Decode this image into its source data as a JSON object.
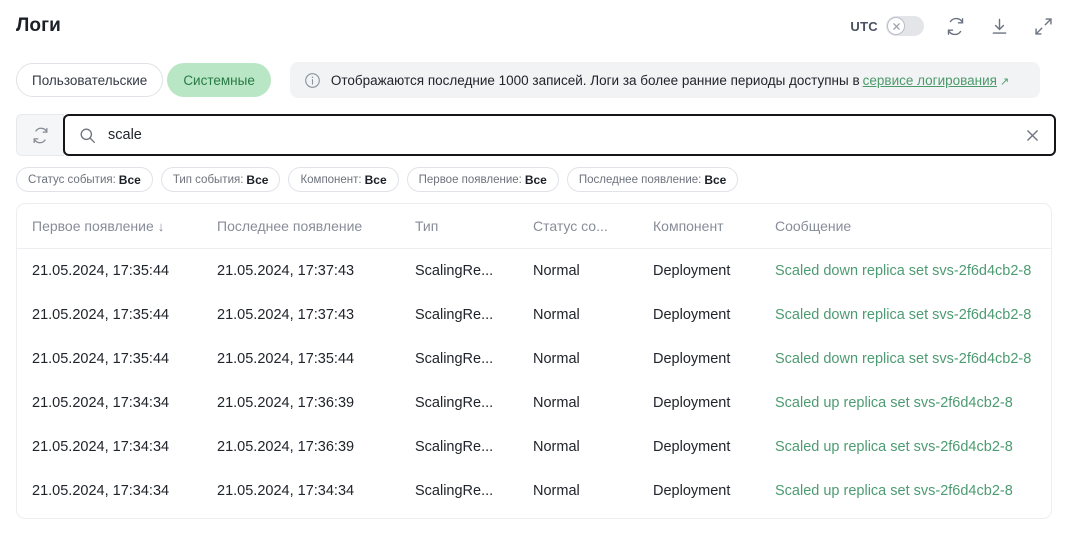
{
  "header": {
    "title": "Логи",
    "utc_label": "UTC",
    "utc_enabled": false,
    "icons": {
      "refresh": "refresh-icon",
      "download": "download-icon",
      "expand": "expand-icon"
    }
  },
  "tabs": [
    {
      "label": "Пользовательские",
      "active": false
    },
    {
      "label": "Системные",
      "active": true
    }
  ],
  "banner": {
    "text": "Отображаются последние 1000 записей. Логи за более ранние периоды доступны в",
    "link": "сервисе логирования",
    "link_arrow": "↗"
  },
  "search": {
    "value": "scale",
    "placeholder": "",
    "refresh_icon": "refresh-icon",
    "search_icon": "search-icon",
    "clear_icon": "close-icon"
  },
  "filters": [
    {
      "label": "Статус события:",
      "value": "Все"
    },
    {
      "label": "Тип события:",
      "value": "Все"
    },
    {
      "label": "Компонент:",
      "value": "Все"
    },
    {
      "label": "Первое появление:",
      "value": "Все"
    },
    {
      "label": "Последнее появление:",
      "value": "Все"
    }
  ],
  "table": {
    "columns": [
      "Первое появление",
      "Последнее появление",
      "Тип",
      "Статус со...",
      "Компонент",
      "Сообщение"
    ],
    "sort_indicator": "↓",
    "rows": [
      {
        "first_seen": "21.05.2024, 17:35:44",
        "last_seen": "21.05.2024, 17:37:43",
        "type": "ScalingRe...",
        "status": "Normal",
        "component": "Deployment",
        "message": "Scaled down replica set svs-2f6d4cb2-8"
      },
      {
        "first_seen": "21.05.2024, 17:35:44",
        "last_seen": "21.05.2024, 17:37:43",
        "type": "ScalingRe...",
        "status": "Normal",
        "component": "Deployment",
        "message": "Scaled down replica set svs-2f6d4cb2-8"
      },
      {
        "first_seen": "21.05.2024, 17:35:44",
        "last_seen": "21.05.2024, 17:35:44",
        "type": "ScalingRe...",
        "status": "Normal",
        "component": "Deployment",
        "message": "Scaled down replica set svs-2f6d4cb2-8"
      },
      {
        "first_seen": "21.05.2024, 17:34:34",
        "last_seen": "21.05.2024, 17:36:39",
        "type": "ScalingRe...",
        "status": "Normal",
        "component": "Deployment",
        "message": "Scaled up replica set svs-2f6d4cb2-8"
      },
      {
        "first_seen": "21.05.2024, 17:34:34",
        "last_seen": "21.05.2024, 17:36:39",
        "type": "ScalingRe...",
        "status": "Normal",
        "component": "Deployment",
        "message": "Scaled up replica set svs-2f6d4cb2-8"
      },
      {
        "first_seen": "21.05.2024, 17:34:34",
        "last_seen": "21.05.2024, 17:34:34",
        "type": "ScalingRe...",
        "status": "Normal",
        "component": "Deployment",
        "message": "Scaled up replica set svs-2f6d4cb2-8"
      }
    ]
  },
  "colors": {
    "accent_green": "#4c9a6a",
    "tab_active_bg": "#b9e6c4",
    "tab_active_text": "#277a46",
    "message_text": "#4d9b72",
    "focus_border": "#14161a"
  }
}
